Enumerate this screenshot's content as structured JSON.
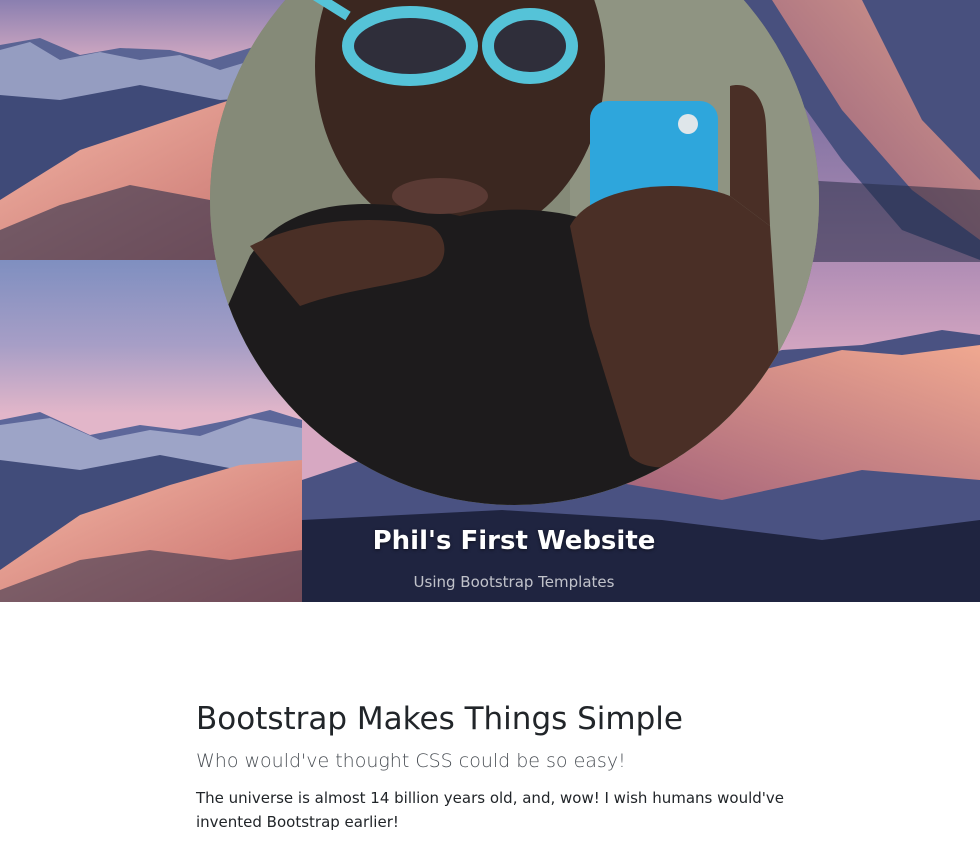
{
  "hero": {
    "title": "Phil's First Website",
    "subtitle": "Using Bootstrap Templates",
    "background": "mountain-landscape-image",
    "avatar": "profile-photo"
  },
  "main": {
    "heading": "Bootstrap Makes Things Simple",
    "lead": "Who would've thought CSS could be so easy!",
    "body": "The universe is almost 14 billion years old, and, wow! I wish humans would've invented Bootstrap earlier!"
  },
  "colors": {
    "sky_top": "#6f6c9e",
    "sky_mid": "#c59ab6",
    "mountain_shadow": "#3f4a78",
    "mountain_lit": "#e7a08f",
    "heading_text": "#212529"
  }
}
